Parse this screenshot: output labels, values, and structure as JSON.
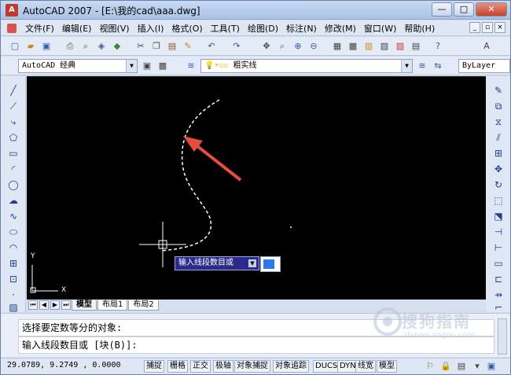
{
  "window": {
    "title": "AutoCAD 2007 - [E:\\我的cad\\aaa.dwg]",
    "controls": {
      "minimize": "—",
      "maximize": "□",
      "close": "✕"
    }
  },
  "menu": {
    "items": [
      "文件(F)",
      "编辑(E)",
      "视图(V)",
      "插入(I)",
      "格式(O)",
      "工具(T)",
      "绘图(D)",
      "标注(N)",
      "修改(M)",
      "窗口(W)",
      "帮助(H)"
    ]
  },
  "toolbar": {
    "workspace": "AutoCAD 经典",
    "layer_value": "粗实线",
    "linetype_value": "ByLayer"
  },
  "canvas": {
    "input_prompt": "输入线段数目或",
    "ucs_x": "X",
    "ucs_y": "Y",
    "colors": {
      "background": "#000000",
      "curve": "#ffffff",
      "arrow": "#e74c3c",
      "tooltip": "#2b2b8a"
    }
  },
  "tabs": [
    "模型",
    "布局1",
    "布局2"
  ],
  "command": {
    "line1": "选择要定数等分的对象:",
    "line2": "输入线段数目或 [块(B)]:"
  },
  "status": {
    "coordinates": "29.0789, 9.2749 , 0.0000",
    "buttons": [
      "捕捉",
      "栅格",
      "正交",
      "极轴",
      "对象捕捉",
      "对象追踪",
      "DUCS",
      "DYN",
      "线宽",
      "模型"
    ]
  },
  "watermark": {
    "main": "搜狗指南",
    "sub": "zhinan.sogou.com"
  }
}
